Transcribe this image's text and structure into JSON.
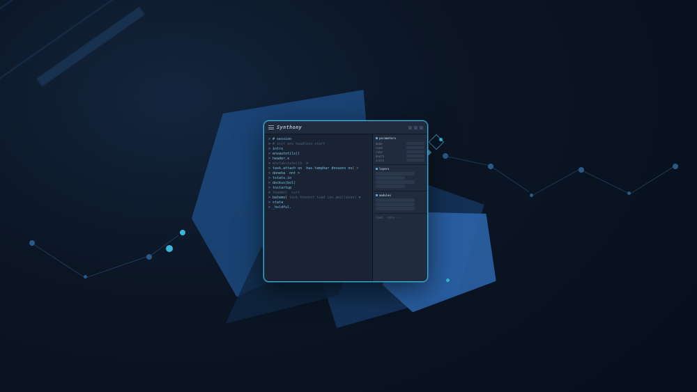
{
  "app": {
    "title": "Synthony"
  },
  "editor": {
    "lines": [
      {
        "cls": "kw",
        "t": "# session"
      },
      {
        "cls": "dim",
        "t": "# init env headless start"
      },
      {
        "cls": "kw",
        "t": "intro"
      },
      {
        "cls": "kw",
        "t": "envautotils()"
      },
      {
        "cls": "kw",
        "t": "header.x"
      },
      {
        "cls": "dim",
        "t": "envtabstate()b  >"
      },
      {
        "cls": "mix",
        "t": "task.attach on  has.temphar dnvuons nx( >",
        "acc": true
      },
      {
        "cls": "kw",
        "t": "doneha  nnt >"
      },
      {
        "cls": "kw",
        "t": "tstats.in"
      },
      {
        "cls": "kw",
        "t": "dockus(bol)"
      },
      {
        "cls": "kw",
        "t": "tnstartup"
      },
      {
        "cls": "dim",
        "t": "feadmel  curt"
      },
      {
        "cls": "mix",
        "t": "batemo( task.thnnbof load inn amcllesen) >( >",
        "acc": true
      },
      {
        "cls": "kw",
        "t": "stata"
      },
      {
        "cls": "kw",
        "t": "_holdful."
      }
    ]
  },
  "panel": {
    "sections": [
      {
        "name": "parameters",
        "rows": [
          "mode",
          "seed",
          "rate",
          "depth",
          "scale"
        ]
      },
      {
        "name": "layers",
        "items": 4
      },
      {
        "name": "modules",
        "items": 3
      }
    ],
    "output_label": "load:  safe: --"
  },
  "colors": {
    "accent": "#3fb2df",
    "code_blue": "#6fa8d6",
    "code_dim": "#4a617e",
    "code_gold": "#e0b04a",
    "panel_bg": "#202b3d",
    "window_bg": "#1a2333"
  }
}
